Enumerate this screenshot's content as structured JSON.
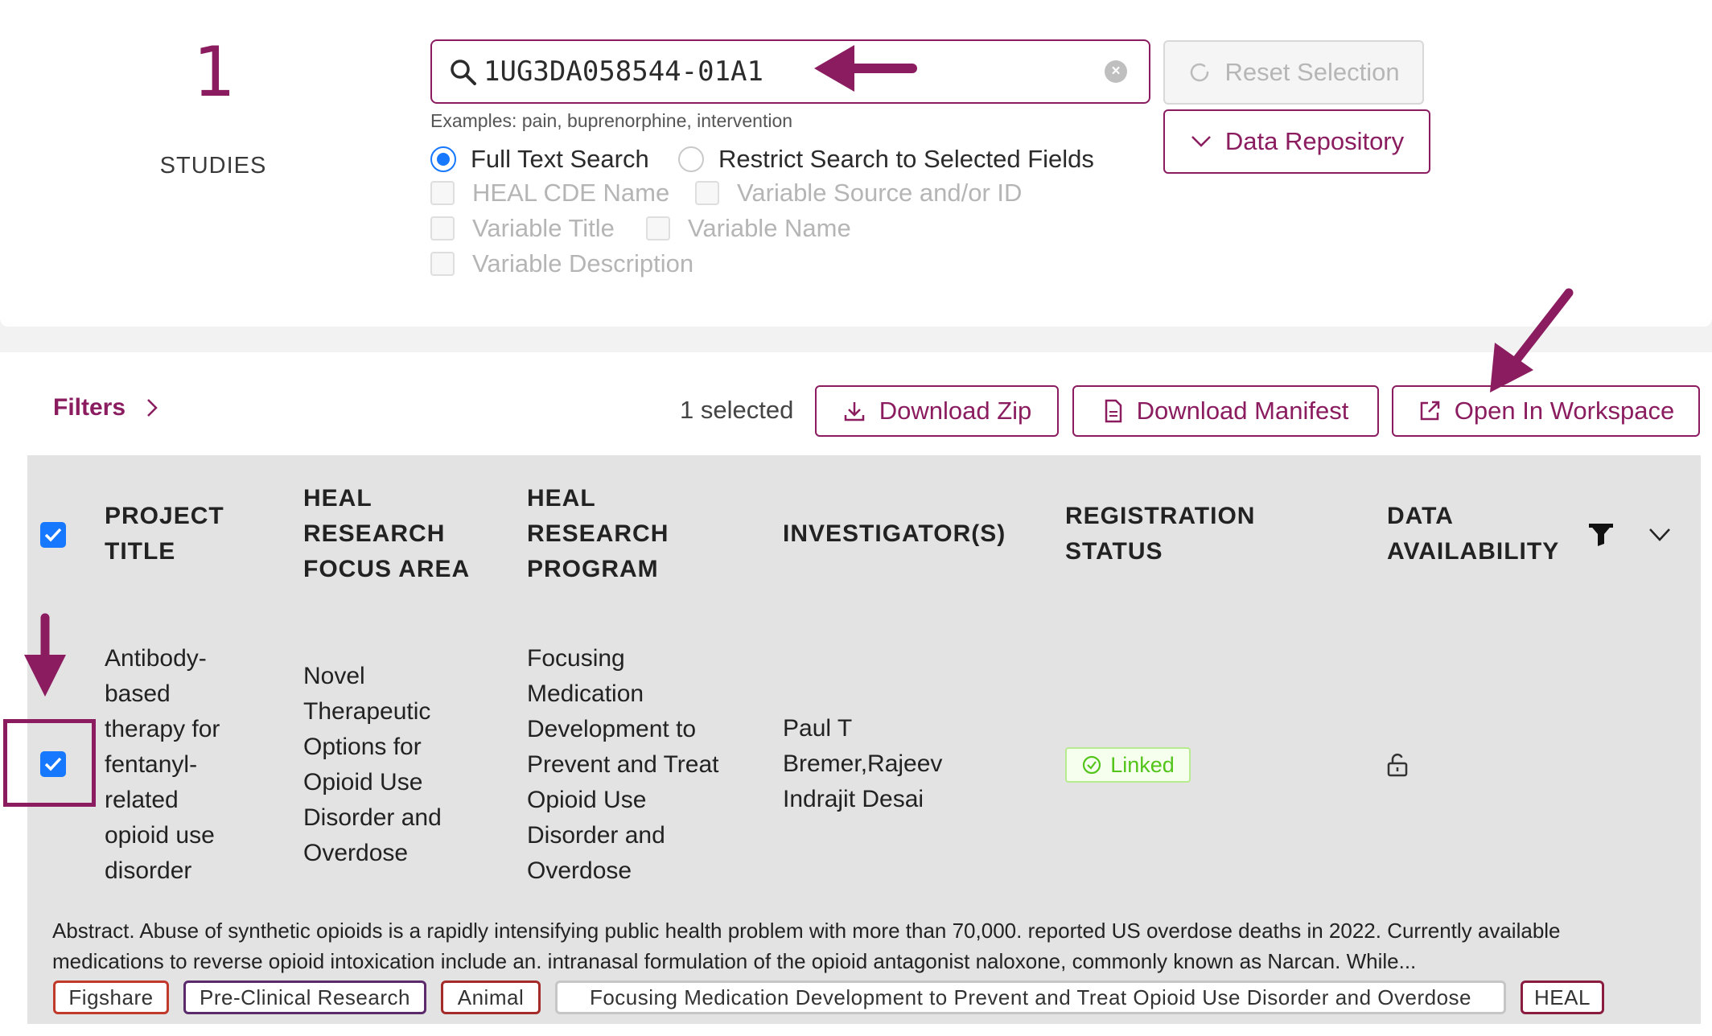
{
  "colors": {
    "accent": "#8a1c5f",
    "checkbox_blue": "#1677ff",
    "linked_green": "#52c41a",
    "table_bg": "#e3e3e3"
  },
  "studies": {
    "count": "1",
    "label": "STUDIES"
  },
  "search": {
    "value": "1UG3DA058544-01A1",
    "examples": "Examples: pain, buprenorphine, intervention",
    "mode_full_text": "Full Text Search",
    "mode_restrict": "Restrict Search to Selected Fields",
    "selected_mode": "Full Text Search",
    "fields": {
      "heal_cde_name": "HEAL CDE Name",
      "variable_source": "Variable Source and/or ID",
      "variable_title": "Variable Title",
      "variable_name": "Variable Name",
      "variable_description": "Variable Description"
    }
  },
  "actions": {
    "reset_selection": "Reset Selection",
    "data_repository": "Data Repository"
  },
  "toolbar": {
    "filters": "Filters",
    "selected_count": "1 selected",
    "download_zip": "Download Zip",
    "download_manifest": "Download Manifest",
    "open_in_workspace": "Open In Workspace"
  },
  "table": {
    "headers": {
      "project_title": "PROJECT TITLE",
      "focus_area": "HEAL RESEARCH FOCUS AREA",
      "program": "HEAL RESEARCH PROGRAM",
      "investigators": "INVESTIGATOR(S)",
      "registration_status": "REGISTRATION STATUS",
      "data_availability": "DATA AVAILABILITY"
    },
    "row": {
      "selected": true,
      "project_title": "Antibody-based therapy for fentanyl-related opioid use disorder",
      "focus_area": "Novel Therapeutic Options for Opioid Use Disorder and Overdose",
      "program": "Focusing Medication Development to Prevent and Treat Opioid Use Disorder and Overdose",
      "investigators": "Paul T Bremer,Rajeev Indrajit Desai",
      "registration_status": "Linked",
      "data_availability_icon": "unlock-icon",
      "abstract": "Abstract. Abuse of synthetic opioids is a rapidly intensifying public health problem with more than 70,000. reported US overdose deaths in 2022. Currently available medications to reverse opioid intoxication include an. intranasal formulation of the opioid antagonist naloxone, commonly known as Narcan. While...",
      "tags": [
        "Figshare",
        "Pre-Clinical Research",
        "Animal",
        "Focusing Medication Development to Prevent and Treat Opioid Use Disorder and Overdose",
        "HEAL"
      ]
    }
  }
}
